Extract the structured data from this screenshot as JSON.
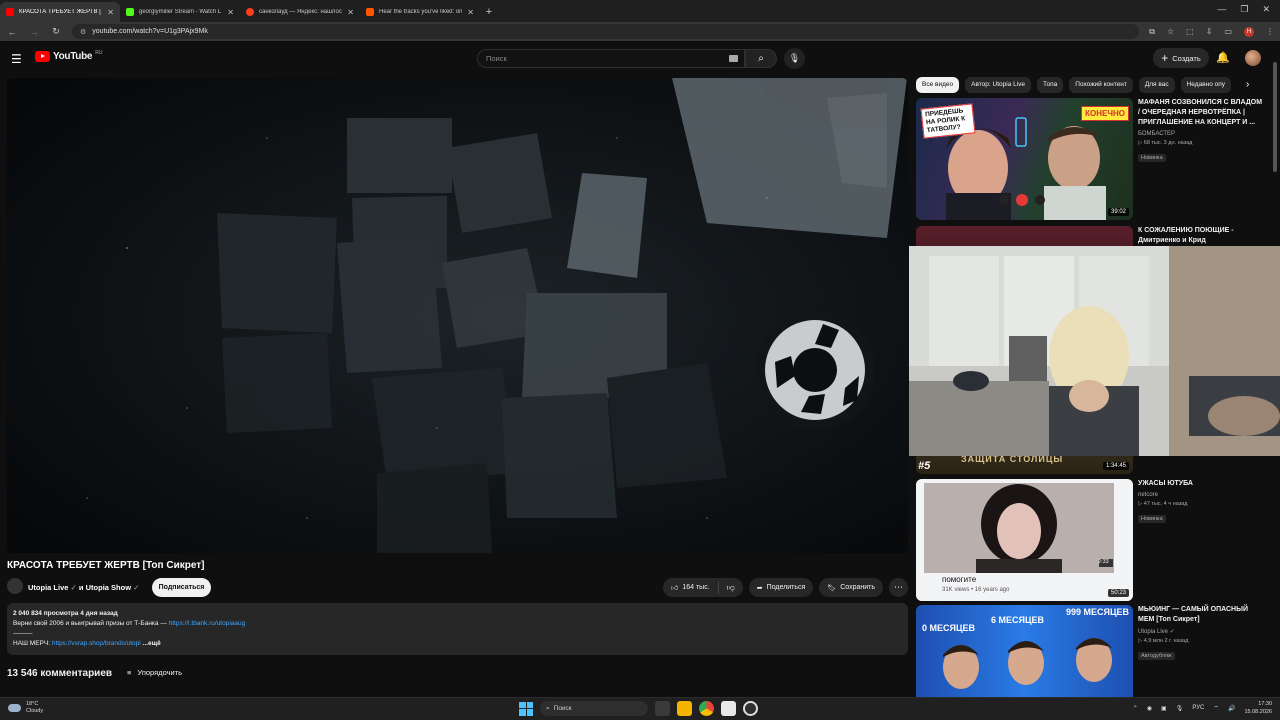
{
  "browser": {
    "tabs": [
      {
        "title": "КРАСОТА ТРЕБУЕТ ЖЕРТВ [Топ",
        "favicon_color": "#ff0000",
        "active": true
      },
      {
        "title": "georgiymiller Stream - Watch L",
        "favicon_color": "#53fc18",
        "active": false
      },
      {
        "title": "санколауд — Яндекс: нашлос",
        "favicon_color": "#fc3f1d",
        "active": false
      },
      {
        "title": "Hear the tracks you've liked: on",
        "favicon_color": "#ff5500",
        "active": false
      }
    ],
    "new_tab": "+",
    "url": "youtube.com/watch?v=U1g3PAjx9Mk",
    "profile_letter": "H"
  },
  "header": {
    "logo_text": "YouTube",
    "logo_region": "RU",
    "search_placeholder": "Поиск",
    "create_label": "Создать"
  },
  "video": {
    "title": "КРАСОТА ТРЕБУЕТ ЖЕРТВ [Топ Сикрет]",
    "channel": "Utopia Live",
    "channel_joiner": "и",
    "channel2": "Utopia Show",
    "subscribe_label": "Подписаться",
    "likes": "164 тыс.",
    "share_label": "Поделиться",
    "save_label": "Сохранить",
    "views_date": "2 040 834 просмотра  4 дня назад",
    "desc_line1": "Верни свой 2006 и выигрывай призы от Т-Банка —",
    "desc_link1": "https://l.tbank.ru/utopiaaug",
    "desc_sep": "———",
    "desc_merch_label": "НАШ МЕРЧ:",
    "desc_link2": "https://vsrap.shop/brands/utopi",
    "desc_more": "...ещё",
    "comments_count": "13 546 комментариев",
    "sort_label": "Упорядочить"
  },
  "chips": [
    "Все видео",
    "Автор: Utopia Live",
    "Топа",
    "Похожий контент",
    "Для вас",
    "Недавно опу"
  ],
  "recommendations": [
    {
      "title": "МАФАНЯ СОЗВОНИЛСЯ С ВЛАДОМ / ОЧЕРЕДНАЯ НЕРВОТРЁПКА | ПРИГЛАШЕНИЕ НА КОНЦЕРТ И ...",
      "channel": "БОМБАСТЕР",
      "stats": "▷ 68 тыс.  3 дн. назад",
      "badge": "Новинка",
      "duration": "39:02",
      "thumb_text_1": "ПРИЕДЕШЬ НА РОЛИК К ТАТВОЛУ?",
      "thumb_text_2": "КОНЕЧНО"
    },
    {
      "title": "К СОЖАЛЕНИЮ ПОЮЩИЕ - Дмитриенко и Крид",
      "duration": "1:34:45",
      "thumb_rank": "#5",
      "thumb_caption": "ЗАЩИТА СТОЛИЦЫ"
    },
    {
      "title": "УЖАСЫ ЮТУБА",
      "channel": "netcore",
      "stats": "▷ 47 тыс.  4 ч назад",
      "badge": "Новинка",
      "duration": "50:23",
      "thumb_caption": "помогите",
      "thumb_sub": "31K views • 16 years ago",
      "thumb_inner_dur": "2:33"
    },
    {
      "title": "МЬЮИНГ — САМЫЙ ОПАСНЫЙ МЕМ [Топ Сикрет]",
      "channel": "Utopia Live",
      "stats": "▷ 4,9 млн  2 г. назад",
      "badge": "Автодубляж",
      "thumb_t1": "0 МЕСЯЦЕВ",
      "thumb_t2": "6 МЕСЯЦЕВ",
      "thumb_t3": "999 МЕСЯЦЕВ"
    }
  ],
  "taskbar": {
    "temp": "18°C",
    "weather": "Cloudy",
    "search": "Поиск",
    "lang": "РУС",
    "time": "17:30",
    "date": "15.08.2026"
  }
}
